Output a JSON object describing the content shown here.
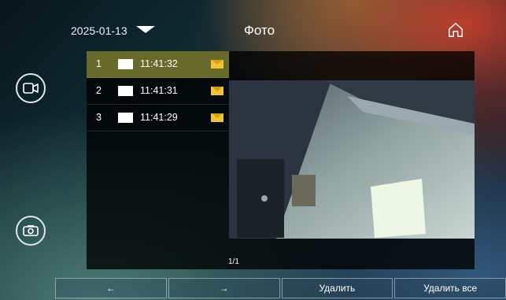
{
  "header": {
    "date": "2025-01-13",
    "title": "Фото"
  },
  "sidebar": {
    "icons": [
      "video-camera-icon",
      "photo-camera-icon"
    ]
  },
  "photos": [
    {
      "num": "1",
      "time": "11:41:32",
      "selected": true
    },
    {
      "num": "2",
      "time": "11:41:31",
      "selected": false
    },
    {
      "num": "3",
      "time": "11:41:29",
      "selected": false
    }
  ],
  "pager": "1/1",
  "footer": {
    "prev": "←",
    "next": "→",
    "delete": "Удалить",
    "delete_all": "Удалить все"
  },
  "colors": {
    "selected_row": "#686a2a",
    "new_badge": "#f1c232"
  }
}
